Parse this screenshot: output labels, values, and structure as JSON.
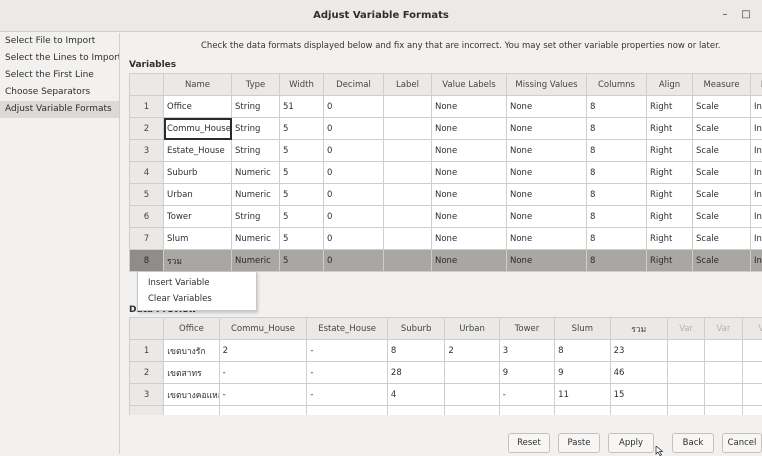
{
  "window": {
    "title": "Adjust Variable Formats",
    "minimize": "–",
    "maximize": "□"
  },
  "sidebar": {
    "items": [
      {
        "label": "Select File to Import"
      },
      {
        "label": "Select the Lines to Import"
      },
      {
        "label": "Select the First Line"
      },
      {
        "label": "Choose Separators"
      },
      {
        "label": "Adjust Variable Formats"
      }
    ]
  },
  "instruction": "Check the data formats displayed below and fix any that are incorrect.  You may set other variable properties now or later.",
  "variables": {
    "heading": "Variables",
    "columns": [
      "",
      "Name",
      "Type",
      "Width",
      "Decimal",
      "Label",
      "Value Labels",
      "Missing Values",
      "Columns",
      "Align",
      "Measure",
      "Role"
    ],
    "rows": [
      [
        "1",
        "Office",
        "String",
        "51",
        "0",
        "",
        "None",
        "None",
        "8",
        "Right",
        "Scale",
        "Input"
      ],
      [
        "2",
        "Commu_House",
        "String",
        "5",
        "0",
        "",
        "None",
        "None",
        "8",
        "Right",
        "Scale",
        "Input"
      ],
      [
        "3",
        "Estate_House",
        "String",
        "5",
        "0",
        "",
        "None",
        "None",
        "8",
        "Right",
        "Scale",
        "Input"
      ],
      [
        "4",
        "Suburb",
        "Numeric",
        "5",
        "0",
        "",
        "None",
        "None",
        "8",
        "Right",
        "Scale",
        "Input"
      ],
      [
        "5",
        "Urban",
        "Numeric",
        "5",
        "0",
        "",
        "None",
        "None",
        "8",
        "Right",
        "Scale",
        "Input"
      ],
      [
        "6",
        "Tower",
        "String",
        "5",
        "0",
        "",
        "None",
        "None",
        "8",
        "Right",
        "Scale",
        "Input"
      ],
      [
        "7",
        "Slum",
        "Numeric",
        "5",
        "0",
        "",
        "None",
        "None",
        "8",
        "Right",
        "Scale",
        "Input"
      ],
      [
        "8",
        "รวม",
        "Numeric",
        "5",
        "0",
        "",
        "None",
        "None",
        "8",
        "Right",
        "Scale",
        "Input"
      ]
    ]
  },
  "context_menu": {
    "items": [
      "Insert Variable",
      "Clear Variables"
    ]
  },
  "preview": {
    "heading": "Data Preview",
    "columns": [
      "",
      "Office",
      "Commu_House",
      "Estate_House",
      "Suburb",
      "Urban",
      "Tower",
      "Slum",
      "รวม",
      "Var",
      "Var",
      "Var"
    ],
    "rows": [
      [
        "1",
        "เขตบางรัก",
        "2",
        "-",
        "8",
        "2",
        "3",
        "8",
        "23",
        "",
        "",
        ""
      ],
      [
        "2",
        "เขตสาทร",
        "-",
        "-",
        "28",
        "",
        "9",
        "9",
        "46",
        "",
        "",
        ""
      ],
      [
        "3",
        "เขตบางคอแหลม",
        "-",
        "-",
        "4",
        "",
        "-",
        "11",
        "15",
        "",
        "",
        ""
      ],
      [
        "",
        "",
        "",
        "",
        "",
        "",
        "",
        "",
        "",
        "",
        "",
        ""
      ]
    ]
  },
  "buttons": {
    "reset": "Reset",
    "paste": "Paste",
    "apply": "Apply",
    "back": "Back",
    "cancel": "Cancel"
  }
}
